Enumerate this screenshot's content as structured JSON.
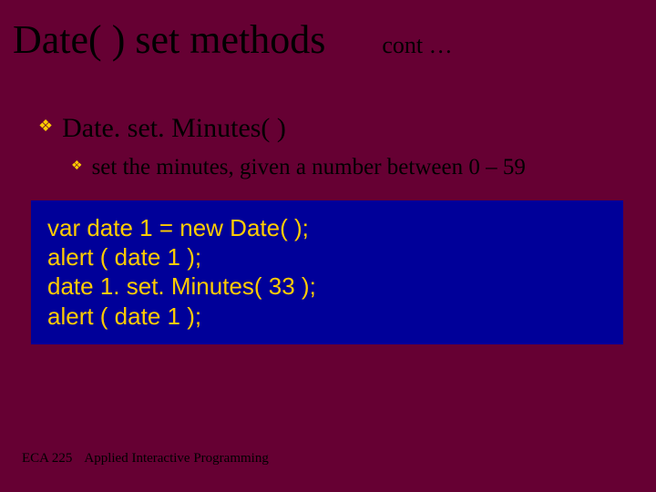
{
  "title": "Date( ) set methods",
  "cont": "cont …",
  "bullet1": "Date. set. Minutes( )",
  "bullet2": "set the minutes, given a number between 0 – 59",
  "code": {
    "l1": "var date 1 = new Date( );",
    "l2": "alert ( date 1 );",
    "l3": "date 1. set. Minutes( 33 );",
    "l4": "alert ( date 1 );"
  },
  "footer": {
    "course": "ECA 225",
    "title": "Applied Interactive Programming"
  }
}
